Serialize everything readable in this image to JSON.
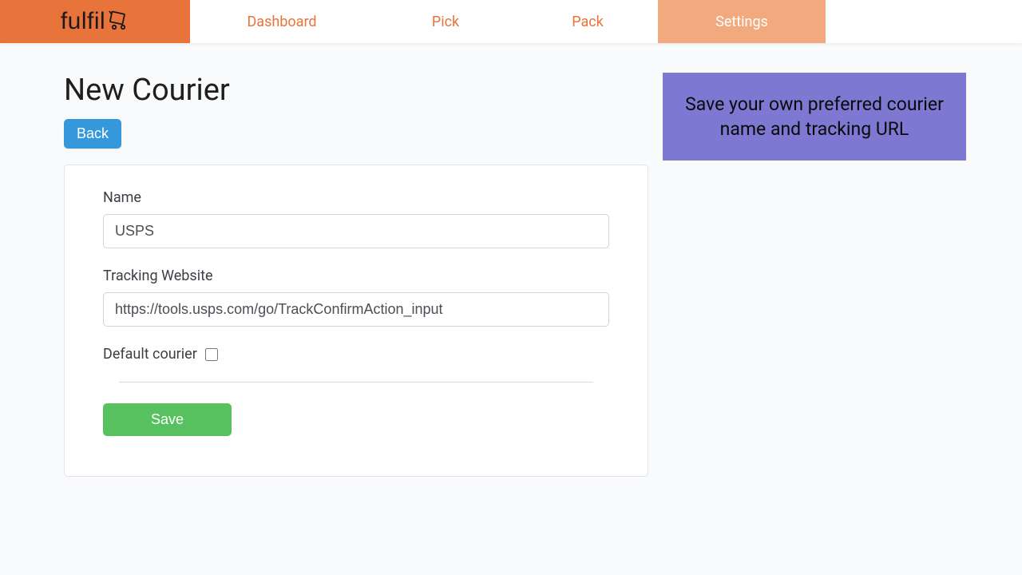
{
  "brand": {
    "name": "fulfil"
  },
  "nav": {
    "dashboard": "Dashboard",
    "pick": "Pick",
    "pack": "Pack",
    "settings": "Settings"
  },
  "page": {
    "title": "New Courier",
    "back_label": "Back"
  },
  "form": {
    "name_label": "Name",
    "name_value": "USPS",
    "tracking_label": "Tracking Website",
    "tracking_value": "https://tools.usps.com/go/TrackConfirmAction_input",
    "default_label": "Default courier",
    "default_checked": false,
    "save_label": "Save"
  },
  "info": {
    "text": "Save your own preferred courier name and tracking URL"
  }
}
